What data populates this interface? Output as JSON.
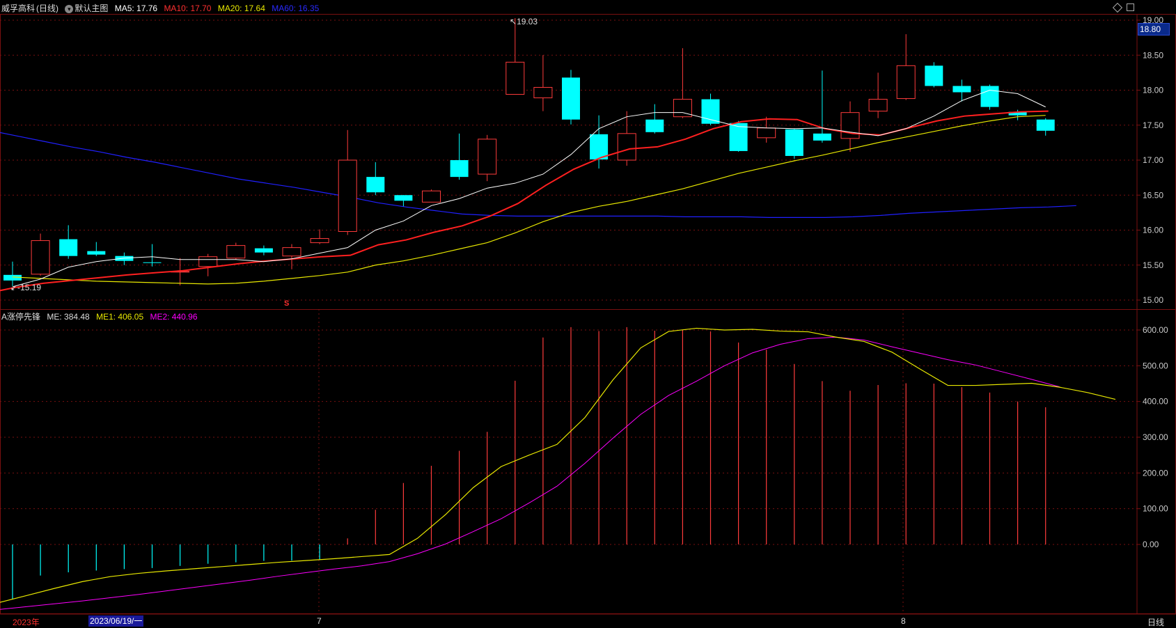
{
  "header": {
    "stock_name": "威孚高科",
    "period": "(日线)",
    "main_chart_name": "默认主图",
    "ma5": "MA5: 17.76",
    "ma10": "MA10: 17.70",
    "ma20": "MA20: 17.64",
    "ma60": "MA60: 16.35",
    "current_price_tag": "18.80",
    "high_label": "19.03",
    "low_label": "15.19",
    "marker": "S"
  },
  "indicator_header": {
    "name": "A涨停先锋",
    "me": "ME: 384.48",
    "me1": "ME1: 406.05",
    "me2": "ME2: 440.96"
  },
  "bottom": {
    "year_label": "2023年",
    "cursor_date": "2023/06/19/一",
    "month_7": "7",
    "month_8": "8",
    "period_button": "日线"
  },
  "colors": {
    "up": "#ff3b3b",
    "down": "#00ffff",
    "ma5": "#ffffff",
    "ma10": "#ff2020",
    "ma20": "#e8e800",
    "ma60": "#2020ff",
    "me1": "#e8e800",
    "me2": "#ff00ff",
    "grid": "#7a1010"
  },
  "chart_data": [
    {
      "type": "candlestick",
      "title": "",
      "y_ticks": [
        "19.00",
        "18.50",
        "18.00",
        "17.50",
        "17.00",
        "16.50",
        "16.00",
        "15.50",
        "15.00"
      ],
      "ylim": [
        14.93,
        19.07
      ],
      "candles": [
        {
          "o": 15.36,
          "h": 15.55,
          "l": 15.2,
          "c": 15.28
        },
        {
          "o": 15.37,
          "h": 15.95,
          "l": 15.35,
          "c": 15.85
        },
        {
          "o": 15.87,
          "h": 16.07,
          "l": 15.59,
          "c": 15.63
        },
        {
          "o": 15.7,
          "h": 15.83,
          "l": 15.63,
          "c": 15.65
        },
        {
          "o": 15.63,
          "h": 15.68,
          "l": 15.5,
          "c": 15.56
        },
        {
          "o": 15.54,
          "h": 15.8,
          "l": 15.48,
          "c": 15.53
        },
        {
          "o": 15.4,
          "h": 15.6,
          "l": 15.21,
          "c": 15.41
        },
        {
          "o": 15.48,
          "h": 15.66,
          "l": 15.34,
          "c": 15.62
        },
        {
          "o": 15.6,
          "h": 15.82,
          "l": 15.58,
          "c": 15.78
        },
        {
          "o": 15.74,
          "h": 15.78,
          "l": 15.64,
          "c": 15.68
        },
        {
          "o": 15.63,
          "h": 15.8,
          "l": 15.44,
          "c": 15.75
        },
        {
          "o": 15.82,
          "h": 16.01,
          "l": 15.8,
          "c": 15.88
        },
        {
          "o": 15.98,
          "h": 17.43,
          "l": 15.93,
          "c": 17.0
        },
        {
          "o": 16.76,
          "h": 16.97,
          "l": 16.5,
          "c": 16.54
        },
        {
          "o": 16.5,
          "h": 16.5,
          "l": 16.34,
          "c": 16.42
        },
        {
          "o": 16.4,
          "h": 16.58,
          "l": 16.4,
          "c": 16.56
        },
        {
          "o": 17.0,
          "h": 17.38,
          "l": 16.72,
          "c": 16.76
        },
        {
          "o": 16.8,
          "h": 17.36,
          "l": 16.7,
          "c": 17.3
        },
        {
          "o": 17.94,
          "h": 19.03,
          "l": 17.94,
          "c": 18.4
        },
        {
          "o": 17.89,
          "h": 18.5,
          "l": 17.7,
          "c": 18.04
        },
        {
          "o": 18.18,
          "h": 18.29,
          "l": 17.51,
          "c": 17.58
        },
        {
          "o": 17.37,
          "h": 17.64,
          "l": 16.88,
          "c": 17.01
        },
        {
          "o": 17.0,
          "h": 17.7,
          "l": 16.92,
          "c": 17.38
        },
        {
          "o": 17.58,
          "h": 17.8,
          "l": 17.38,
          "c": 17.4
        },
        {
          "o": 17.62,
          "h": 18.6,
          "l": 17.6,
          "c": 17.87
        },
        {
          "o": 17.87,
          "h": 17.95,
          "l": 17.5,
          "c": 17.52
        },
        {
          "o": 17.53,
          "h": 17.56,
          "l": 17.12,
          "c": 17.13
        },
        {
          "o": 17.32,
          "h": 17.62,
          "l": 17.25,
          "c": 17.46
        },
        {
          "o": 17.44,
          "h": 17.45,
          "l": 17.02,
          "c": 17.06
        },
        {
          "o": 17.38,
          "h": 18.28,
          "l": 17.25,
          "c": 17.28
        },
        {
          "o": 17.31,
          "h": 17.84,
          "l": 17.12,
          "c": 17.68
        },
        {
          "o": 17.7,
          "h": 18.25,
          "l": 17.6,
          "c": 17.87
        },
        {
          "o": 17.88,
          "h": 18.8,
          "l": 17.86,
          "c": 18.35
        },
        {
          "o": 18.35,
          "h": 18.4,
          "l": 18.04,
          "c": 18.06
        },
        {
          "o": 18.06,
          "h": 18.15,
          "l": 17.84,
          "c": 17.97
        },
        {
          "o": 18.06,
          "h": 18.08,
          "l": 17.72,
          "c": 17.76
        },
        {
          "o": 17.69,
          "h": 17.72,
          "l": 17.57,
          "c": 17.64
        },
        {
          "o": 17.58,
          "h": 17.6,
          "l": 17.35,
          "c": 17.42
        }
      ],
      "ma5": [
        15.19,
        15.3,
        15.47,
        15.55,
        15.6,
        15.62,
        15.58,
        15.58,
        15.58,
        15.55,
        15.59,
        15.67,
        15.75,
        16.0,
        16.13,
        16.35,
        16.45,
        16.6,
        16.67,
        16.8,
        17.08,
        17.45,
        17.62,
        17.68,
        17.68,
        17.58,
        17.48,
        17.46,
        17.45,
        17.46,
        17.4,
        17.35,
        17.45,
        17.63,
        17.85,
        18.0,
        17.95,
        17.76
      ],
      "ma10": [
        15.1,
        15.18,
        15.24,
        15.28,
        15.32,
        15.36,
        15.39,
        15.42,
        15.47,
        15.52,
        15.56,
        15.59,
        15.62,
        15.64,
        15.79,
        15.86,
        15.97,
        16.06,
        16.2,
        16.38,
        16.64,
        16.87,
        17.04,
        17.16,
        17.19,
        17.3,
        17.45,
        17.55,
        17.59,
        17.58,
        17.45,
        17.38,
        17.36,
        17.46,
        17.56,
        17.63,
        17.66,
        17.69,
        17.7
      ],
      "ma20": [
        15.33,
        15.31,
        15.29,
        15.27,
        15.26,
        15.25,
        15.24,
        15.23,
        15.24,
        15.27,
        15.31,
        15.35,
        15.4,
        15.5,
        15.56,
        15.64,
        15.73,
        15.82,
        15.96,
        16.12,
        16.25,
        16.34,
        16.41,
        16.5,
        16.59,
        16.7,
        16.81,
        16.9,
        16.99,
        17.07,
        17.16,
        17.25,
        17.33,
        17.41,
        17.49,
        17.56,
        17.62,
        17.64
      ],
      "ma60": [
        17.43,
        17.35,
        17.27,
        17.19,
        17.12,
        17.04,
        16.97,
        16.89,
        16.81,
        16.73,
        16.67,
        16.61,
        16.54,
        16.47,
        16.39,
        16.33,
        16.28,
        16.23,
        16.21,
        16.2,
        16.2,
        16.2,
        16.2,
        16.2,
        16.2,
        16.19,
        16.19,
        16.19,
        16.18,
        16.18,
        16.18,
        16.19,
        16.21,
        16.24,
        16.26,
        16.28,
        16.3,
        16.32,
        16.33,
        16.35
      ]
    },
    {
      "type": "bar",
      "title": "A涨停先锋",
      "y_ticks": [
        "600.00",
        "500.00",
        "400.00",
        "300.00",
        "200.00",
        "100.00",
        "0.00"
      ],
      "ylim": [
        -180,
        620
      ],
      "me": [
        -152,
        -87,
        -78,
        -73,
        -69,
        -66,
        -60,
        -54,
        -50,
        -46,
        -45,
        -43,
        17,
        97,
        172,
        220,
        262,
        315,
        458,
        579,
        608,
        597,
        608,
        598,
        601,
        596,
        565,
        545,
        505,
        457,
        430,
        446,
        451,
        450,
        440,
        425,
        400,
        384
      ],
      "me1": [
        -163,
        -143,
        -123,
        -104,
        -90,
        -81,
        -74,
        -68,
        -62,
        -56,
        -50,
        -45,
        -40,
        -34,
        -28,
        17,
        83,
        159,
        218,
        250,
        280,
        355,
        460,
        550,
        596,
        605,
        600,
        602,
        597,
        595,
        580,
        568,
        538,
        491,
        445,
        445,
        448,
        451,
        440,
        425,
        406
      ],
      "me2": [
        -182,
        -174,
        -166,
        -158,
        -149,
        -140,
        -130,
        -120,
        -110,
        -100,
        -89,
        -79,
        -69,
        -60,
        -48,
        -26,
        1,
        36,
        72,
        116,
        163,
        227,
        297,
        364,
        417,
        457,
        500,
        536,
        560,
        576,
        580,
        572,
        553,
        535,
        517,
        502,
        482,
        462,
        441
      ]
    }
  ]
}
